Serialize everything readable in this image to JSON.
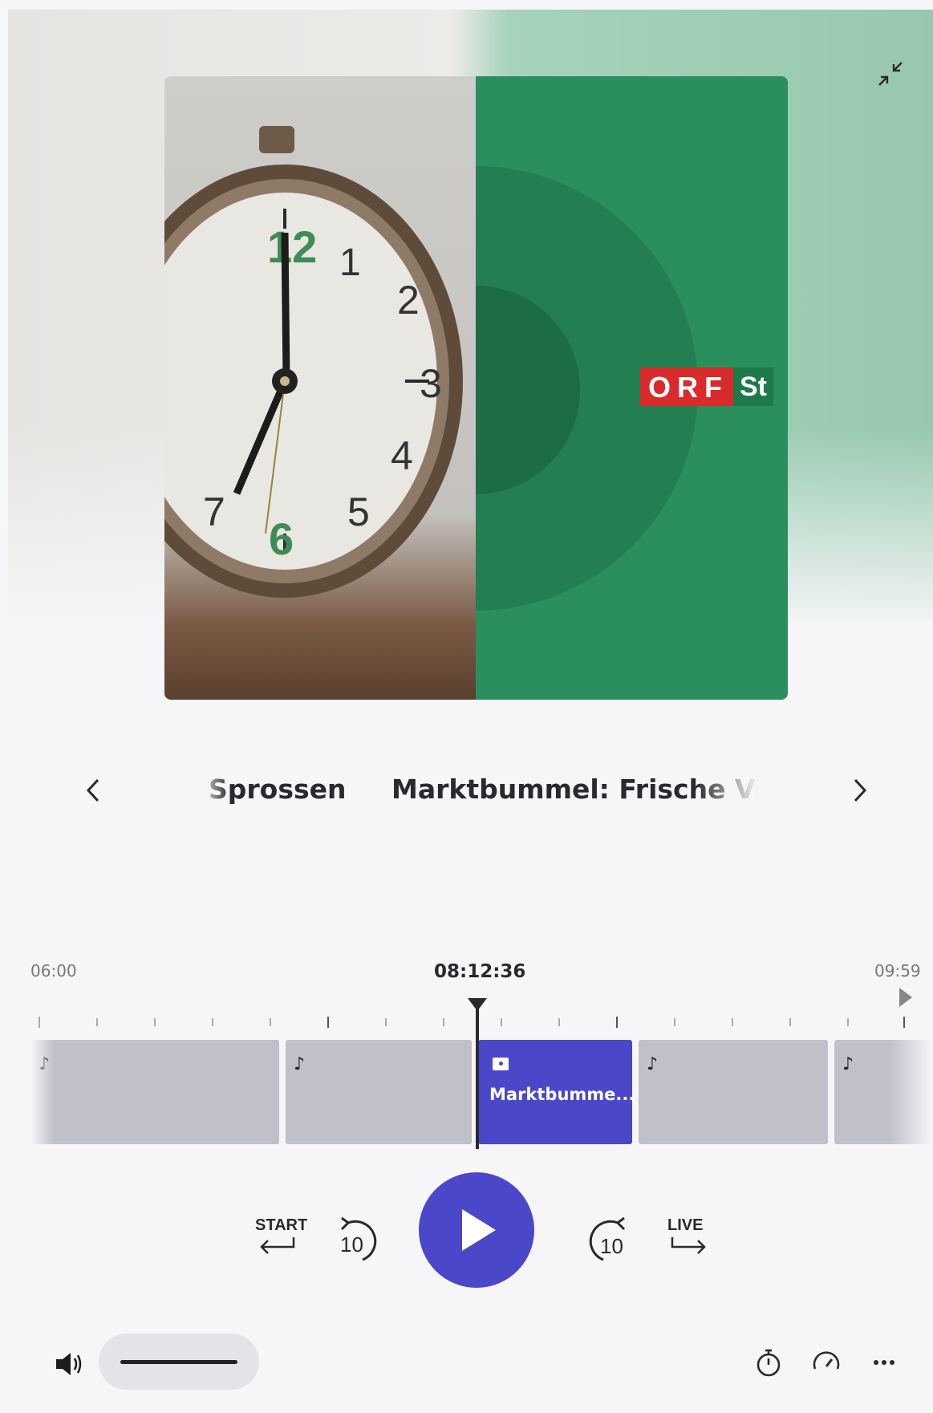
{
  "colors": {
    "accent": "#4a48c8",
    "segment": "#bfc0ca",
    "orf_red": "#d92b2b",
    "orf_green": "#1e7a4a"
  },
  "header": {
    "minimize_icon": "collapse-arrows-icon"
  },
  "cover": {
    "logo_left": "ORF",
    "logo_right": "St"
  },
  "carousel": {
    "prev_icon": "chevron-left-icon",
    "next_icon": "chevron-right-icon",
    "items": [
      "Sprossen",
      "Marktbummel: Frische Vita"
    ]
  },
  "timeline": {
    "start": "06:00",
    "current": "08:12:36",
    "end": "09:59",
    "active_segment_label": "Marktbumme...",
    "segment_icons": [
      "music-note-icon",
      "music-note-icon",
      "tv-icon",
      "music-note-icon",
      "music-note-icon"
    ]
  },
  "controls": {
    "start_label": "START",
    "back_seconds": "10",
    "forward_seconds": "10",
    "live_label": "LIVE",
    "play_icon": "play-icon"
  },
  "footer": {
    "volume_icon": "speaker-icon",
    "volume_level": 0.75,
    "timer_icon": "stopwatch-icon",
    "speed_icon": "speedometer-icon",
    "more_icon": "more-icon"
  }
}
